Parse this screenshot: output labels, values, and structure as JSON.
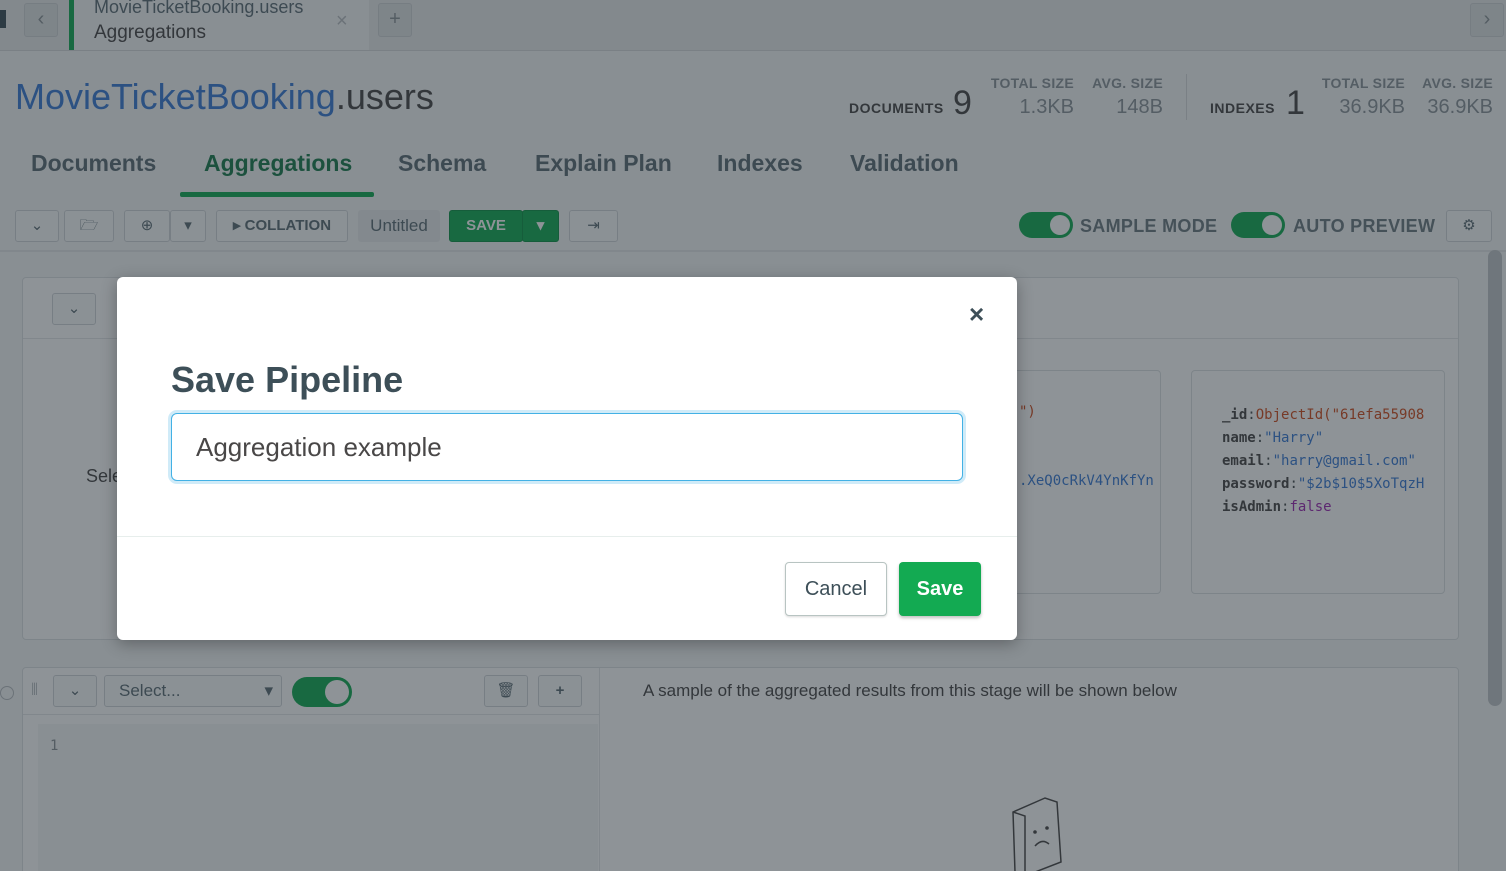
{
  "tabbar": {
    "back_icon": "‹",
    "tab_db_coll": "MovieTicketBooking.users",
    "tab_subtitle": "Aggregations",
    "close_icon": "×",
    "new_tab_icon": "+",
    "forward_icon": "›"
  },
  "header": {
    "db_name": "MovieTicketBooking",
    "coll_name": ".users",
    "documents_label": "DOCUMENTS",
    "documents_count": "9",
    "doc_total_size_label": "TOTAL SIZE",
    "doc_total_size": "1.3KB",
    "doc_avg_size_label": "AVG. SIZE",
    "doc_avg_size": "148B",
    "indexes_label": "INDEXES",
    "indexes_count": "1",
    "idx_total_size_label": "TOTAL SIZE",
    "idx_total_size": "36.9KB",
    "idx_avg_size_label": "AVG. SIZE",
    "idx_avg_size": "36.9KB"
  },
  "tabs": [
    "Documents",
    "Aggregations",
    "Schema",
    "Explain Plan",
    "Indexes",
    "Validation"
  ],
  "toolbar": {
    "collation_label": "COLLATION",
    "pipeline_name": "Untitled",
    "save_label": "SAVE",
    "sample_mode_label": "SAMPLE MODE",
    "auto_preview_label": "AUTO PREVIEW"
  },
  "preview": {
    "partial_text": "Sele",
    "doc_fragment_1": "\")",
    "doc_fragment_2": ".XeQ0cRkV4YnKfYn",
    "doc": [
      {
        "key": "_id",
        "value": "ObjectId(\"61efa55908",
        "type": "oid"
      },
      {
        "key": "name",
        "value": "\"Harry\"",
        "type": "str"
      },
      {
        "key": "email",
        "value": "\"harry@gmail.com\"",
        "type": "str"
      },
      {
        "key": "password",
        "value": "\"$2b$10$5XoTqzH",
        "type": "str"
      },
      {
        "key": "isAdmin",
        "value": "false",
        "type": "bool"
      }
    ]
  },
  "stage": {
    "select_placeholder": "Select...",
    "add_icon": "+",
    "line_number": "1",
    "results_hint": "A sample of the aggregated results from this stage will be shown below"
  },
  "modal": {
    "title": "Save Pipeline",
    "input_value": "Aggregation example",
    "cancel_label": "Cancel",
    "save_label": "Save",
    "close_icon": "×"
  }
}
